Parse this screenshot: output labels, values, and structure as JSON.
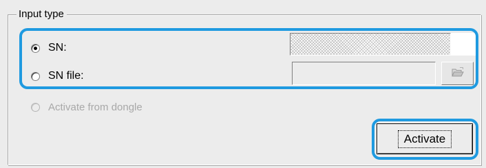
{
  "groupbox": {
    "title": "Input type"
  },
  "options": {
    "sn": {
      "label": "SN:",
      "checked": true
    },
    "sn_file": {
      "label": "SN file:",
      "checked": false
    },
    "dongle": {
      "label": "Activate from dongle",
      "checked": false,
      "disabled": true
    }
  },
  "fields": {
    "sn_value": "",
    "sn_file_value": ""
  },
  "icons": {
    "browse": "folder-open-icon"
  },
  "buttons": {
    "activate": "Activate"
  },
  "colors": {
    "highlight": "#1f9ae0",
    "panel_background": "#ececec",
    "disabled_text": "#a8a8a8"
  }
}
